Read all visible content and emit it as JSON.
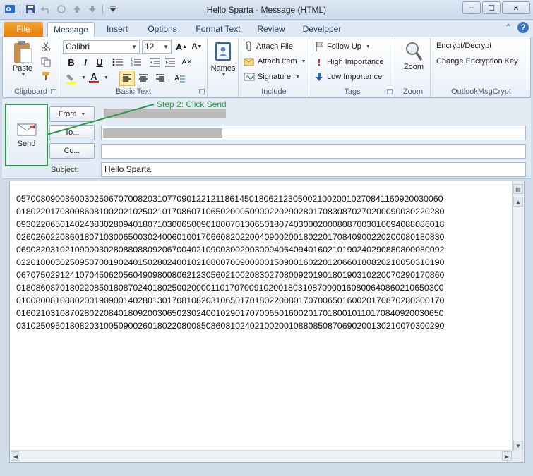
{
  "window": {
    "title": "Hello Sparta  -  Message (HTML)",
    "buttons": [
      "–",
      "☐",
      "✕"
    ]
  },
  "qat": {
    "save_icon": "save-icon",
    "undo_icon": "undo-icon",
    "redo_icon": "redo-icon",
    "up_icon": "up-arrow-icon",
    "down_icon": "down-arrow-icon",
    "customize_icon": "customize-icon"
  },
  "tabs": {
    "file": "File",
    "items": [
      "Message",
      "Insert",
      "Options",
      "Format Text",
      "Review",
      "Developer"
    ]
  },
  "ribbon": {
    "clipboard": {
      "label": "Clipboard",
      "paste": "Paste"
    },
    "basic_text": {
      "label": "Basic Text",
      "font": "Calibri",
      "size": "12"
    },
    "names": {
      "label": "Names"
    },
    "include": {
      "label": "Include",
      "attach_file": "Attach File",
      "attach_item": "Attach Item",
      "signature": "Signature"
    },
    "tags": {
      "label": "Tags",
      "follow_up": "Follow Up",
      "high": "High Importance",
      "low": "Low Importance"
    },
    "zoom": {
      "label": "Zoom",
      "zoom": "Zoom"
    },
    "crypt": {
      "label": "OutlookMsgCrypt",
      "encrypt": "Encrypt/Decrypt",
      "change_key": "Change Encryption Key"
    }
  },
  "header": {
    "send": "Send",
    "from": "From",
    "to": "To...",
    "cc": "Cc...",
    "subject_label": "Subject:",
    "subject_value": "Hello Sparta",
    "annotation": "Step 2: Click Send"
  },
  "body": {
    "lines": [
      "0570080900360030250670700820310770901221211861450180621230500210020010270841160920030060",
      "0180220170800860810020210250210170860710650200050900220290280170830870270200090030220280",
      "0930220650140240830280940180710300650090180070130650180740300020008087003010094088086018",
      "0260260220860180710300650030240060100170660820220040900200180220170840900220200080180830",
      "0690820310210900030280880880920670040210900300290300940640940160210190240290880800080092",
      "0220180050250950700190240150280240010210800700900300150900160220120660180820210050310190",
      "0670750291241070450620560490980080621230560210020830270800920190180190310220070290170860",
      "0180860870180220850180870240180250020000110170700910200180310870000160800640860210650300",
      "0100800810880200190900140280130170810820310650170180220080170700650160020170870280300170",
      "0160210310870280220840180920030650230240010290170700650160020170180010110170840920030650",
      "0310250950180820310050900260180220800850860810240210020010880850870690200130210070300290"
    ]
  }
}
